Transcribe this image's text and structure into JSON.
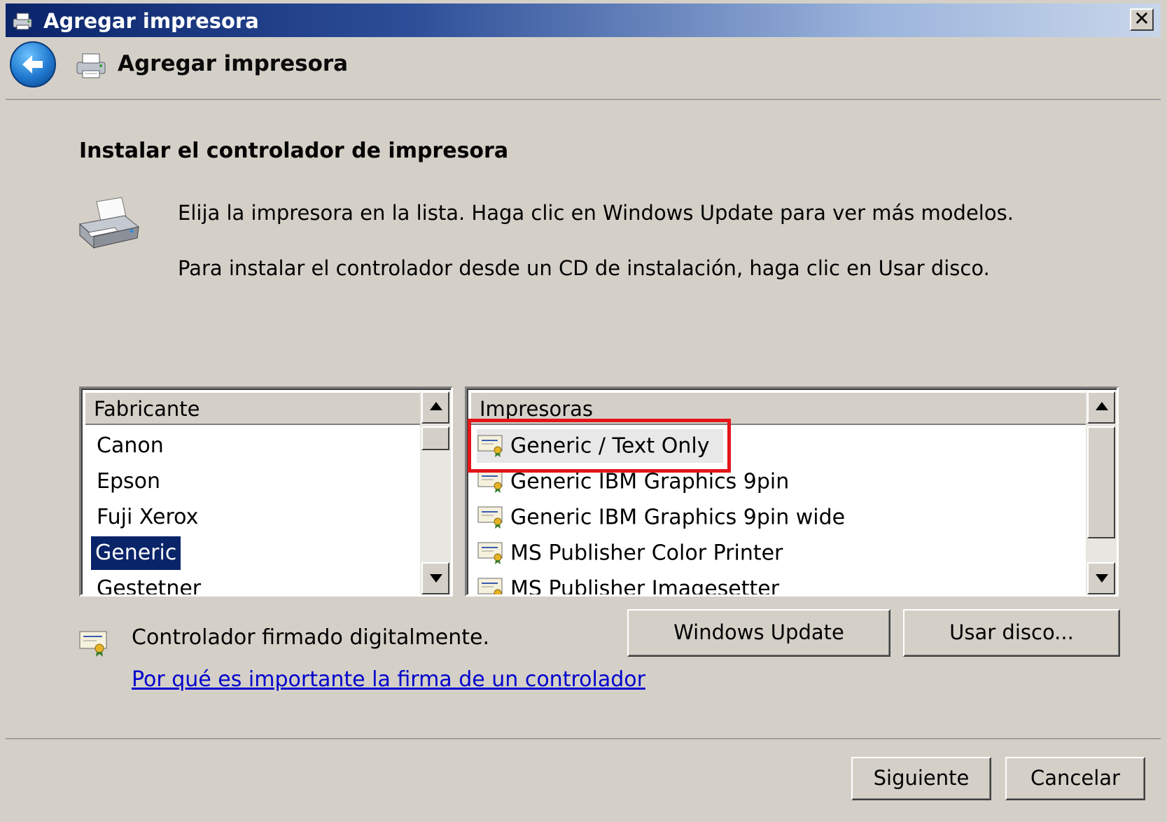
{
  "window": {
    "title": "Agregar impresora",
    "close_glyph": "✕"
  },
  "header": {
    "title": "Agregar impresora"
  },
  "content": {
    "section_title": "Instalar el controlador de impresora",
    "instruction_1": "Elija la impresora en la lista. Haga clic en Windows Update para ver más modelos.",
    "instruction_2": "Para instalar el controlador desde un CD de instalación, haga clic en Usar disco."
  },
  "manufacturer_list": {
    "header": "Fabricante",
    "items": [
      "Canon",
      "Epson",
      "Fuji Xerox",
      "Generic",
      "Gestetner"
    ],
    "selected": "Generic"
  },
  "printer_list": {
    "header": "Impresoras",
    "items": [
      "Generic / Text Only",
      "Generic IBM Graphics 9pin",
      "Generic IBM Graphics 9pin wide",
      "MS Publisher Color Printer",
      "MS Publisher Imagesetter"
    ],
    "selected": "Generic / Text Only"
  },
  "buttons": {
    "windows_update": "Windows Update",
    "use_disk": "Usar disco...",
    "next": "Siguiente",
    "cancel": "Cancelar"
  },
  "signature": {
    "status_text": "Controlador firmado digitalmente.",
    "link_text": "Por qué es importante la firma de un controlador"
  },
  "colors": {
    "selection": "#0a246a",
    "highlight_box": "#e2161b",
    "link": "#0000cc"
  }
}
